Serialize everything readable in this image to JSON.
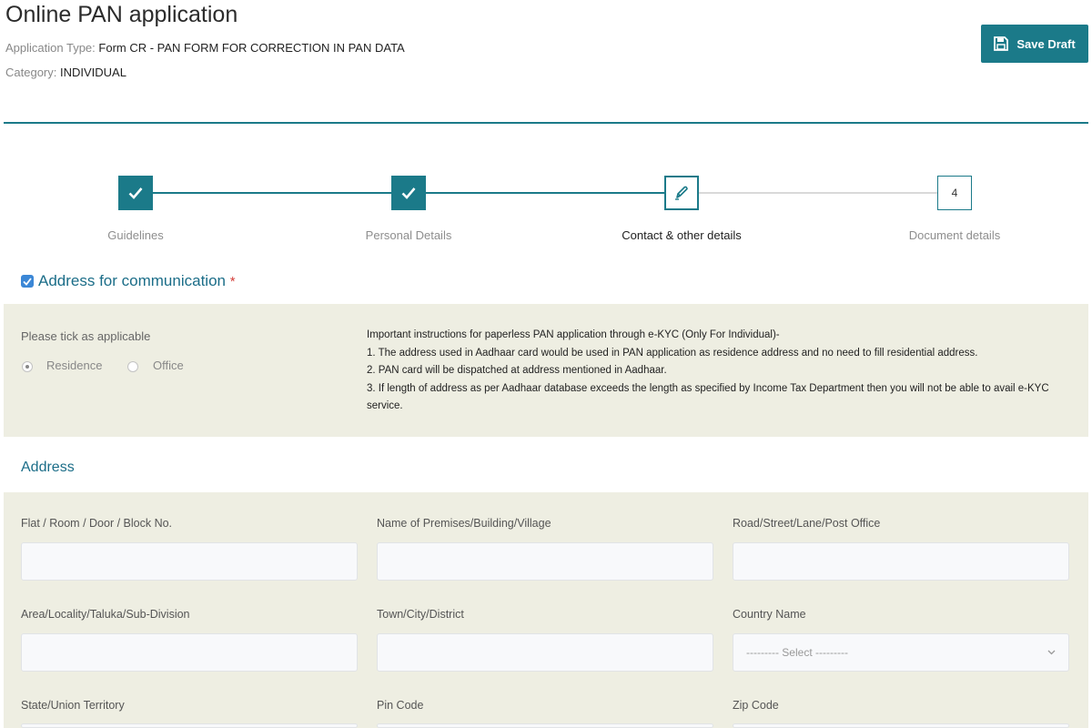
{
  "header": {
    "title": "Online PAN application",
    "app_type_label": "Application Type:",
    "app_type_value": "Form CR - PAN FORM FOR CORRECTION IN PAN DATA",
    "category_label": "Category:",
    "category_value": "INDIVIDUAL",
    "save_draft_label": "Save Draft"
  },
  "steps": [
    {
      "label": "Guidelines",
      "state": "done"
    },
    {
      "label": "Personal Details",
      "state": "done"
    },
    {
      "label": "Contact & other details",
      "state": "current"
    },
    {
      "label": "Document details",
      "state": "pending",
      "number": "4"
    }
  ],
  "communication": {
    "title": "Address for communication",
    "required_mark": "*",
    "checked": true,
    "tick_label": "Please tick as applicable",
    "options": [
      {
        "label": "Residence",
        "selected": true
      },
      {
        "label": "Office",
        "selected": false
      }
    ],
    "instructions": {
      "heading": "Important instructions for paperless PAN application through e-KYC (Only For Individual)-",
      "items": [
        "1. The address used in Aadhaar card would be used in PAN application as residence address and no need to fill residential address.",
        "2. PAN card will be dispatched at address mentioned in Aadhaar.",
        "3. If length of address as per Aadhaar database exceeds the length as specified by Income Tax Department then you will not be able to avail e-KYC service."
      ]
    }
  },
  "address": {
    "title": "Address",
    "fields": {
      "flat": {
        "label": "Flat / Room / Door / Block No.",
        "value": ""
      },
      "premises": {
        "label": "Name of Premises/Building/Village",
        "value": ""
      },
      "road": {
        "label": "Road/Street/Lane/Post Office",
        "value": ""
      },
      "area": {
        "label": "Area/Locality/Taluka/Sub-Division",
        "value": ""
      },
      "town": {
        "label": "Town/City/District",
        "value": ""
      },
      "country": {
        "label": "Country Name",
        "selected": "--------- Select ---------"
      },
      "state": {
        "label": "State/Union Territory",
        "value": ""
      },
      "pin": {
        "label": "Pin Code",
        "value": ""
      },
      "zip": {
        "label": "Zip Code",
        "value": ""
      }
    }
  },
  "colors": {
    "accent": "#1b7a89",
    "panel_bg": "#eeeee2",
    "checkbox": "#3b87d6",
    "required": "#d43f3a"
  },
  "icons": {
    "save": "floppy-disk-icon",
    "done": "checkmark-icon",
    "current": "pencil-icon",
    "collapse": "chevron-down-icon"
  }
}
